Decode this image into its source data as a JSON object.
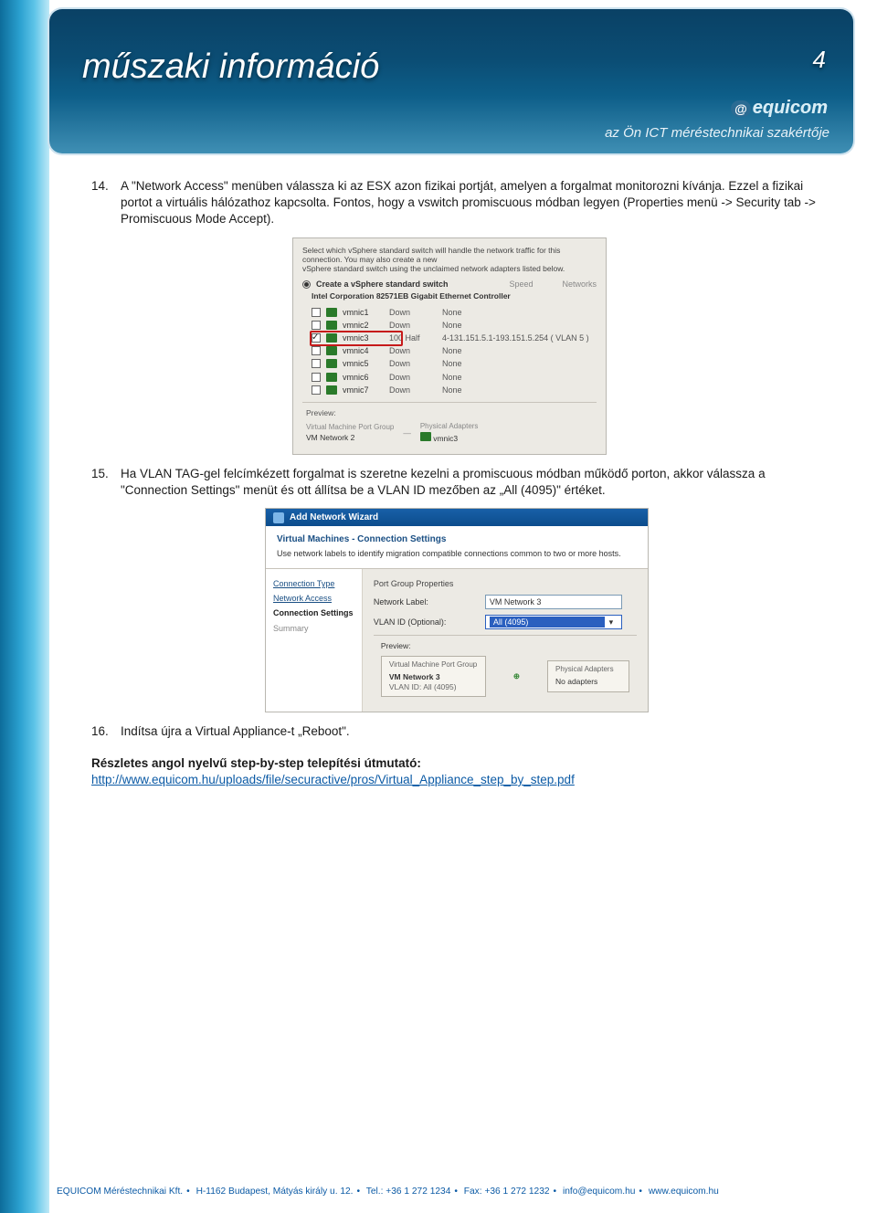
{
  "banner": {
    "title": "műszaki információ",
    "subtitle": "az Ön ICT méréstechnikai szakértője",
    "page_number": "4",
    "logo_at": "@",
    "logo_text": "equicom"
  },
  "steps": {
    "s14_num": "14.",
    "s14_text": "A \"Network Access\" menüben válassza ki az ESX azon fizikai portját, amelyen a forgalmat monitorozni kívánja. Ezzel a fizikai portot a virtuális hálózathoz kapcsolta. Fontos, hogy a vswitch promiscuous módban legyen (Properties menü -> Security tab -> Promiscuous Mode Accept).",
    "s15_num": "15.",
    "s15_text": "Ha VLAN TAG-gel felcímkézett forgalmat is szeretne kezelni a promiscuous módban működő porton, akkor válassza a \"Connection Settings\" menüt és ott állítsa be a VLAN ID mezőben az „All (4095)\" értéket.",
    "s16_num": "16.",
    "s16_text": "Indítsa újra a Virtual Appliance-t „Reboot\"."
  },
  "shot1": {
    "desc1": "Select which vSphere standard switch will handle the network traffic for this connection. You may also create a new",
    "desc2": "vSphere standard switch using the unclaimed network adapters listed below.",
    "create_label": "Create a vSphere standard switch",
    "col_speed": "Speed",
    "col_net": "Networks",
    "controller": "Intel Corporation 82571EB Gigabit Ethernet Controller",
    "nics": [
      {
        "name": "vmnic1",
        "speed": "Down",
        "net": "None",
        "checked": false
      },
      {
        "name": "vmnic2",
        "speed": "Down",
        "net": "None",
        "checked": false
      },
      {
        "name": "vmnic3",
        "speed": "100 Half",
        "net": "4-131.151.5.1-193.151.5.254 ( VLAN 5 )",
        "checked": true
      },
      {
        "name": "vmnic4",
        "speed": "Down",
        "net": "None",
        "checked": false
      },
      {
        "name": "vmnic5",
        "speed": "Down",
        "net": "None",
        "checked": false
      },
      {
        "name": "vmnic6",
        "speed": "Down",
        "net": "None",
        "checked": false
      },
      {
        "name": "vmnic7",
        "speed": "Down",
        "net": "None",
        "checked": false
      }
    ],
    "preview_label": "Preview:",
    "prev_vm": "Virtual Machine Port Group",
    "prev_vm_name": "VM Network 2",
    "prev_pa": "Physical Adapters",
    "prev_pa_name": "vmnic3"
  },
  "shot2": {
    "wizard": "Add Network Wizard",
    "heading": "Virtual Machines - Connection Settings",
    "sub": "Use network labels to identify migration compatible connections common to two or more hosts.",
    "side": {
      "conn_type": "Connection Type",
      "net_access": "Network Access",
      "conn_set": "Connection Settings",
      "summary": "Summary"
    },
    "group_label": "Port Group Properties",
    "nl_label": "Network Label:",
    "nl_value": "VM Network 3",
    "vlan_label": "VLAN ID (Optional):",
    "vlan_value": "All (4095)",
    "preview_label": "Preview:",
    "vm_group": "Virtual Machine Port Group",
    "vm_name": "VM Network 3",
    "vlan_line": "VLAN ID: All (4095)",
    "pa_label": "Physical Adapters",
    "pa_value": "No adapters"
  },
  "conclusion": {
    "bold": "Részletes angol nyelvű step-by-step telepítési útmutató:",
    "link": "http://www.equicom.hu/uploads/file/securactive/pros/Virtual_Appliance_step_by_step.pdf"
  },
  "footer": {
    "company": "EQUICOM Méréstechnikai Kft.",
    "address": "H-1162 Budapest, Mátyás király u. 12.",
    "tel": "Tel.: +36 1 272 1234",
    "fax": "Fax: +36 1 272 1232",
    "email": "info@equicom.hu",
    "web": "www.equicom.hu"
  }
}
